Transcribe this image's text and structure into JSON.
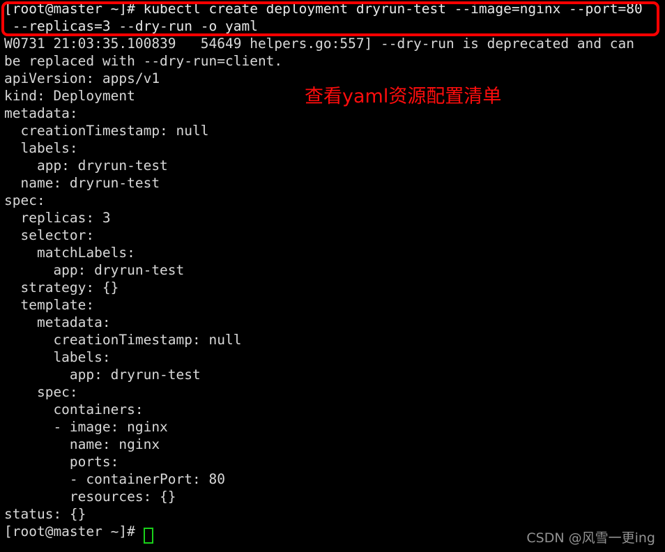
{
  "terminal": {
    "prompt": "[root@master ~]#",
    "background_color": "#000000",
    "text_color": "#d8d8d8",
    "lines": [
      "[root@master ~]# kubectl create deployment dryrun-test --image=nginx --port=80",
      " --replicas=3 --dry-run -o yaml",
      "W0731 21:03:35.100839   54649 helpers.go:557] --dry-run is deprecated and can",
      "be replaced with --dry-run=client.",
      "apiVersion: apps/v1",
      "kind: Deployment",
      "metadata:",
      "  creationTimestamp: null",
      "  labels:",
      "    app: dryrun-test",
      "  name: dryrun-test",
      "spec:",
      "  replicas: 3",
      "  selector:",
      "    matchLabels:",
      "      app: dryrun-test",
      "  strategy: {}",
      "  template:",
      "    metadata:",
      "      creationTimestamp: null",
      "      labels:",
      "        app: dryrun-test",
      "    spec:",
      "      containers:",
      "      - image: nginx",
      "        name: nginx",
      "        ports:",
      "        - containerPort: 80",
      "        resources: {}",
      "status: {}",
      "[root@master ~]# "
    ]
  },
  "annotations": {
    "command_box": {
      "label": "command-highlight",
      "color": "#ff0000"
    },
    "yaml_callout": {
      "text": "查看yaml资源配置清单",
      "color": "#ff0d0d"
    },
    "cursor": {
      "color": "#19d119"
    }
  },
  "watermark": {
    "text": "CSDN @风雪一更ing",
    "color": "#9a9a9a"
  }
}
